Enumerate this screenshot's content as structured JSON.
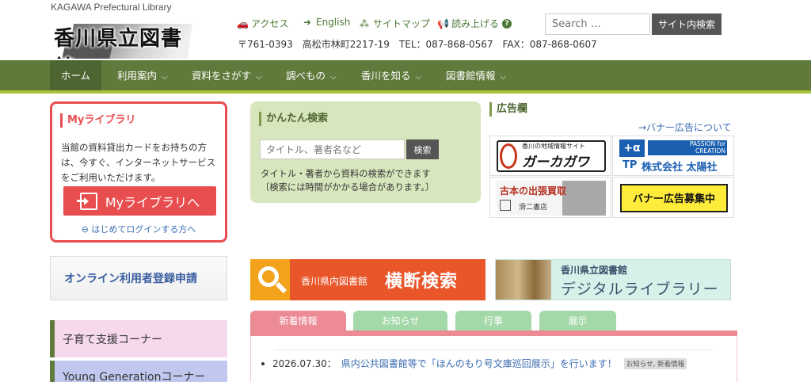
{
  "header": {
    "english_name": "KAGAWA Prefectural Library",
    "logo_text": "香川県立図書館",
    "links": [
      {
        "label": "アクセス",
        "icon": "car-icon"
      },
      {
        "label": "English",
        "icon": "arrow-right-circle-icon"
      },
      {
        "label": "サイトマップ",
        "icon": "sitemap-icon"
      },
      {
        "label": "読み上げる",
        "icon": "megaphone-icon"
      }
    ],
    "address": "〒761-0393　高松市林町2217-19　TEL：087-868-0567　FAX：087-868-0607",
    "search_placeholder": "Search …",
    "search_button": "サイト内検索"
  },
  "nav": {
    "items": [
      {
        "label": "ホーム"
      },
      {
        "label": "利用案内"
      },
      {
        "label": "資料をさがす"
      },
      {
        "label": "調べもの"
      },
      {
        "label": "香川を知る"
      },
      {
        "label": "図書館情報"
      }
    ]
  },
  "mylibrary": {
    "title": "Myライブラリ",
    "description": "当館の資料貸出カードをお持ちの方は、今すぐ、インターネットサービスをご利用いただけます。",
    "button": "Myライブラリへ",
    "first_login": "はじめてログインする方へ"
  },
  "quick_search": {
    "title": "かんたん検索",
    "placeholder": "タイトル、著者名など",
    "button": "検索",
    "desc_line1": "タイトル・著者から資料の検索ができます",
    "desc_line2": "〔検索には時間がかかる場合があります。〕"
  },
  "ads": {
    "title": "広告欄",
    "about_link": "→バナー広告について",
    "ad1_sub": "香川の地域情報サイト",
    "ad1_main": "ガーカガワ",
    "ad2_top": "PASSION for CREATION",
    "ad2_main": "株式会社 太陽社",
    "ad3_main": "古本の出張買取",
    "ad3_sub": "滑二書店",
    "ad4_main": "バナー広告募集中"
  },
  "sidebar": {
    "online": "オンライン利用者登録申請",
    "kosodate": "子育て支援コーナー",
    "young": "Young Generationコーナー"
  },
  "banners": {
    "oudan_sub": "香川県内図書館",
    "oudan_main": "横断検索",
    "digital_sub": "香川県立図書館",
    "digital_main": "デジタルライブラリー"
  },
  "tabs": [
    {
      "label": "新着情報"
    },
    {
      "label": "お知らせ"
    },
    {
      "label": "行事"
    },
    {
      "label": "展示"
    }
  ],
  "news": [
    {
      "date": "2026.07.30：",
      "title": "県内公共図書館等で「ほんのもり号文庫巡回展示」を行います！",
      "tags": "お知らせ, 新着情報"
    }
  ],
  "colors": {
    "nav_bg": "#607a3b",
    "nav_accent": "#a8c13b",
    "mylib_red": "#e84e50",
    "quick_bg": "#d7e6bd",
    "tab_active": "#ec8a95",
    "tab_inactive": "#a3d8a8"
  }
}
